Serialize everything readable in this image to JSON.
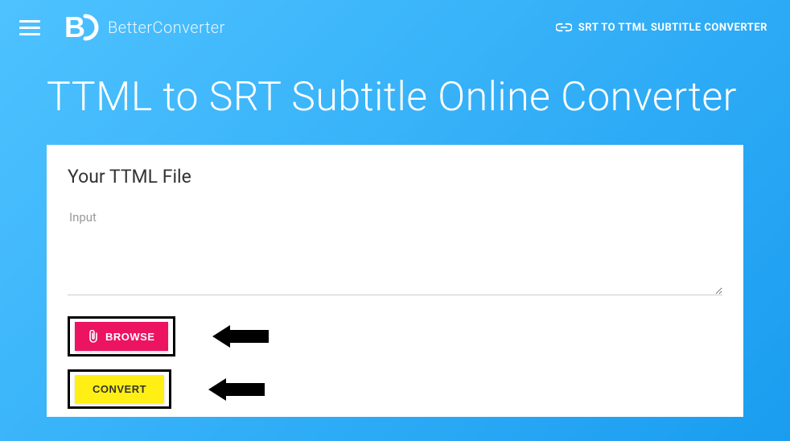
{
  "header": {
    "brand_name": "BetterConverter",
    "nav_link_label": "SRT TO TTML SUBTITLE CONVERTER",
    "menu_icon": "menu-icon",
    "link_icon": "link-icon"
  },
  "page": {
    "title": "TTML to SRT Subtitle Online Converter"
  },
  "form": {
    "section_title": "Your TTML File",
    "input_placeholder": "Input",
    "input_value": "",
    "browse_label": "BROWSE",
    "convert_label": "CONVERT",
    "browse_icon": "paperclip-icon"
  },
  "annotations": {
    "arrow_browse": "arrow-highlight-browse",
    "arrow_convert": "arrow-highlight-convert"
  }
}
